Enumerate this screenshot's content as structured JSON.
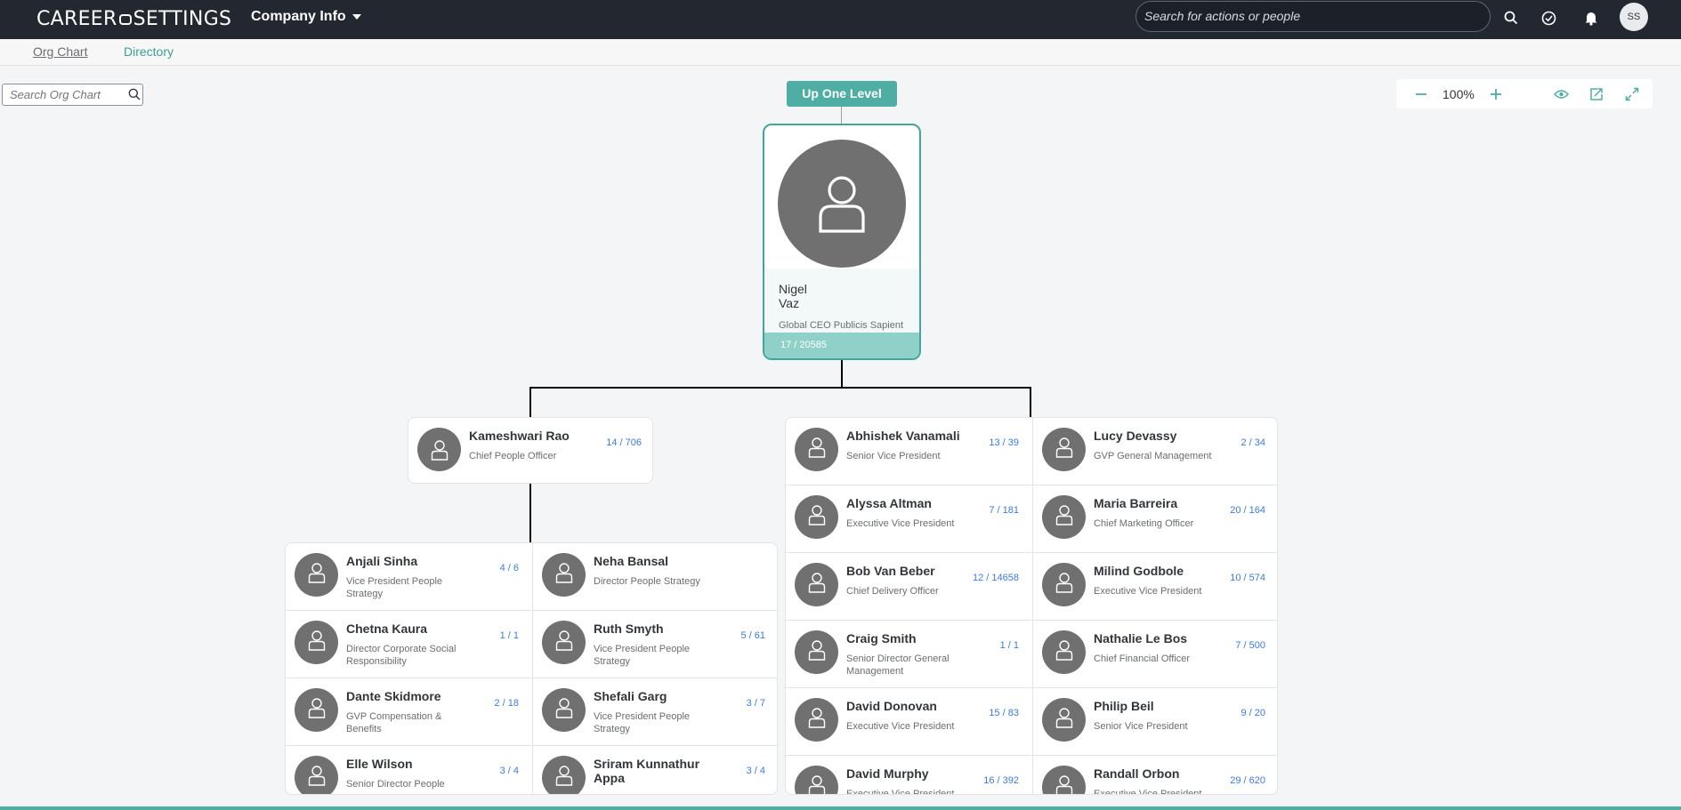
{
  "shell": {
    "brand_left": "CAREER",
    "brand_right": "SETTINGS",
    "company_menu": "Company Info",
    "search_placeholder": "Search for actions or people",
    "avatar_initials": "SS"
  },
  "tabs": {
    "org_chart": "Org Chart",
    "directory": "Directory"
  },
  "org_search": {
    "placeholder": "Search Org Chart"
  },
  "zoom": {
    "value": "100%"
  },
  "up_level": "Up One Level",
  "root": {
    "first_name": "Nigel",
    "last_name": "Vaz",
    "title": "Global CEO Publicis Sapient",
    "count": "17 / 20585"
  },
  "left_manager": {
    "name": "Kameshwari Rao",
    "title": "Chief People Officer",
    "count": "14 / 706"
  },
  "left_reports": [
    {
      "name": "Anjali Sinha",
      "title": "Vice President People Strategy",
      "count": "4 / 6"
    },
    {
      "name": "Neha Bansal",
      "title": "Director People Strategy",
      "count": ""
    },
    {
      "name": "Chetna Kaura",
      "title": "Director Corporate Social Responsibility",
      "count": "1 / 1"
    },
    {
      "name": "Ruth Smyth",
      "title": "Vice President People Strategy",
      "count": "5 / 61"
    },
    {
      "name": "Dante Skidmore",
      "title": "GVP Compensation & Benefits",
      "count": "2 / 18"
    },
    {
      "name": "Shefali Garg",
      "title": "Vice President People Strategy",
      "count": "3 / 7"
    },
    {
      "name": "Elle Wilson",
      "title": "Senior Director People",
      "count": "3 / 4"
    },
    {
      "name": "Sriram Kunnathur Appa",
      "title": "",
      "count": "3 / 4"
    }
  ],
  "right_reports": [
    {
      "name": "Abhishek Vanamali",
      "title": "Senior Vice President",
      "count": "13 / 39"
    },
    {
      "name": "Lucy Devassy",
      "title": "GVP General Management",
      "count": "2 / 34"
    },
    {
      "name": "Alyssa Altman",
      "title": "Executive Vice President",
      "count": "7 / 181"
    },
    {
      "name": "Maria Barreira",
      "title": "Chief Marketing Officer",
      "count": "20 / 164"
    },
    {
      "name": "Bob Van Beber",
      "title": "Chief Delivery Officer",
      "count": "12 / 14658"
    },
    {
      "name": "Milind Godbole",
      "title": "Executive Vice President",
      "count": "10 / 574"
    },
    {
      "name": "Craig Smith",
      "title": "Senior Director General Management",
      "count": "1 / 1"
    },
    {
      "name": "Nathalie Le Bos",
      "title": "Chief Financial Officer",
      "count": "7 / 500"
    },
    {
      "name": "David Donovan",
      "title": "Executive Vice President",
      "count": "15 / 83"
    },
    {
      "name": "Philip Beil",
      "title": "Senior Vice President",
      "count": "9 / 20"
    },
    {
      "name": "David Murphy",
      "title": "Executive Vice President",
      "count": "16 / 392"
    },
    {
      "name": "Randall Orbon",
      "title": "Executive Vice President",
      "count": "29 / 620"
    }
  ],
  "colors": {
    "shell": "#232830",
    "accent": "#4eaea4",
    "link": "#3b7be0",
    "avatar": "#707070"
  },
  "icons": [
    "search-icon",
    "task-check-icon",
    "bell-icon",
    "zoom-out-icon",
    "zoom-in-icon",
    "eye-icon",
    "export-icon",
    "fullscreen-icon",
    "person-icon"
  ]
}
